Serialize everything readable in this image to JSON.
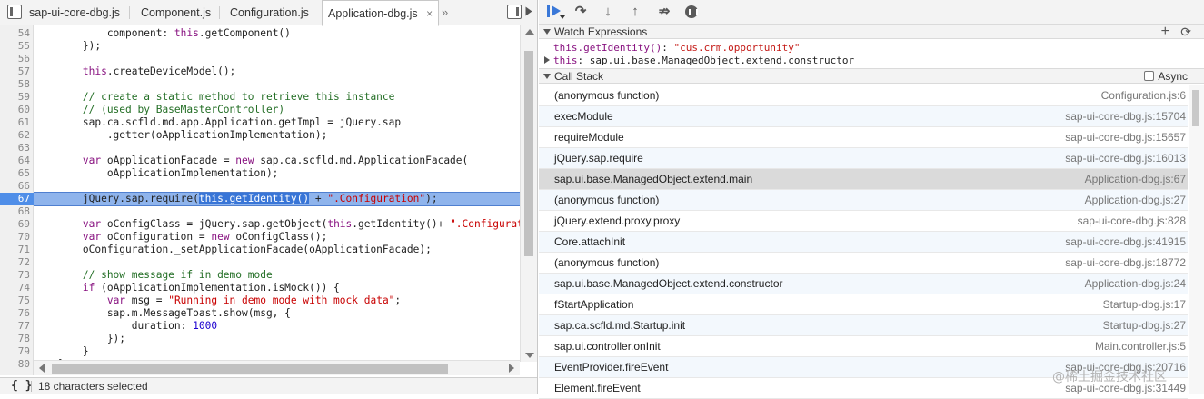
{
  "tabs": [
    {
      "label": "sap-ui-core-dbg.js",
      "active": false
    },
    {
      "label": "Component.js",
      "active": false
    },
    {
      "label": "Configuration.js",
      "active": false
    },
    {
      "label": "Application-dbg.js",
      "active": true,
      "close": "×"
    }
  ],
  "tabs_more": "»",
  "code_lines": [
    {
      "num": "54",
      "tokens": [
        {
          "t": "            component: "
        },
        {
          "t": "this",
          "c": "kw"
        },
        {
          "t": ".getComponent()"
        }
      ]
    },
    {
      "num": "55",
      "tokens": [
        {
          "t": "        });"
        }
      ]
    },
    {
      "num": "56",
      "tokens": []
    },
    {
      "num": "57",
      "tokens": [
        {
          "t": "        "
        },
        {
          "t": "this",
          "c": "kw"
        },
        {
          "t": ".createDeviceModel();"
        }
      ]
    },
    {
      "num": "58",
      "tokens": []
    },
    {
      "num": "59",
      "tokens": [
        {
          "t": "        // create a static method to retrieve this instance",
          "c": "cmt"
        }
      ]
    },
    {
      "num": "60",
      "tokens": [
        {
          "t": "        // (used by BaseMasterController)",
          "c": "cmt"
        }
      ]
    },
    {
      "num": "61",
      "tokens": [
        {
          "t": "        sap.ca.scfld.md.app.Application.getImpl = jQuery.sap"
        }
      ]
    },
    {
      "num": "62",
      "tokens": [
        {
          "t": "            .getter(oApplicationImplementation);"
        }
      ]
    },
    {
      "num": "63",
      "tokens": []
    },
    {
      "num": "64",
      "tokens": [
        {
          "t": "        "
        },
        {
          "t": "var",
          "c": "kw"
        },
        {
          "t": " oApplicationFacade = "
        },
        {
          "t": "new",
          "c": "kw"
        },
        {
          "t": " sap.ca.scfld.md.ApplicationFacade("
        }
      ]
    },
    {
      "num": "65",
      "tokens": [
        {
          "t": "            oApplicationImplementation);"
        }
      ]
    },
    {
      "num": "66",
      "tokens": []
    },
    {
      "num": "67",
      "exec": true,
      "tokens": [
        {
          "t": "        jQuery.sap.require("
        },
        {
          "t": "this.getIdentity()",
          "c": "sel"
        },
        {
          "t": " + "
        },
        {
          "t": "\".Configuration\"",
          "c": "str"
        },
        {
          "t": ");"
        }
      ]
    },
    {
      "num": "68",
      "tokens": []
    },
    {
      "num": "69",
      "tokens": [
        {
          "t": "        "
        },
        {
          "t": "var",
          "c": "kw"
        },
        {
          "t": " oConfigClass = jQuery.sap.getObject("
        },
        {
          "t": "this",
          "c": "kw"
        },
        {
          "t": ".getIdentity()+ "
        },
        {
          "t": "\".Configurati",
          "c": "str"
        }
      ]
    },
    {
      "num": "70",
      "tokens": [
        {
          "t": "        "
        },
        {
          "t": "var",
          "c": "kw"
        },
        {
          "t": " oConfiguration = "
        },
        {
          "t": "new",
          "c": "kw"
        },
        {
          "t": " oConfigClass();"
        }
      ]
    },
    {
      "num": "71",
      "tokens": [
        {
          "t": "        oConfiguration._setApplicationFacade(oApplicationFacade);"
        }
      ]
    },
    {
      "num": "72",
      "tokens": []
    },
    {
      "num": "73",
      "tokens": [
        {
          "t": "        // show message if in demo mode",
          "c": "cmt"
        }
      ]
    },
    {
      "num": "74",
      "tokens": [
        {
          "t": "        "
        },
        {
          "t": "if",
          "c": "kw"
        },
        {
          "t": " (oApplicationImplementation.isMock()) {"
        }
      ]
    },
    {
      "num": "75",
      "tokens": [
        {
          "t": "            "
        },
        {
          "t": "var",
          "c": "kw"
        },
        {
          "t": " msg = "
        },
        {
          "t": "\"Running in demo mode with mock data\"",
          "c": "str"
        },
        {
          "t": ";"
        }
      ]
    },
    {
      "num": "76",
      "tokens": [
        {
          "t": "            sap.m.MessageToast.show(msg, {"
        }
      ]
    },
    {
      "num": "77",
      "tokens": [
        {
          "t": "                duration: "
        },
        {
          "t": "1000",
          "c": "num"
        }
      ]
    },
    {
      "num": "78",
      "tokens": [
        {
          "t": "            });"
        }
      ]
    },
    {
      "num": "79",
      "tokens": [
        {
          "t": "        }"
        }
      ]
    },
    {
      "num": "80",
      "tokens": [
        {
          "t": "    },"
        }
      ]
    }
  ],
  "statusbar": {
    "format_label": "{ }",
    "selection": "18 characters selected"
  },
  "watch": {
    "title": "Watch Expressions",
    "add": "+",
    "refresh": "⟳",
    "items": [
      {
        "expr": "this.getIdentity()",
        "sep": ": ",
        "value": "\"cus.crm.opportunity\"",
        "kind": "str"
      },
      {
        "expr": "this",
        "sep": ": ",
        "value": "sap.ui.base.ManagedObject.extend.constructor",
        "kind": "obj"
      }
    ]
  },
  "callstack": {
    "title": "Call Stack",
    "async_label": "Async",
    "async_checked": false,
    "frames": [
      {
        "name": "(anonymous function)",
        "loc": "Configuration.js:6"
      },
      {
        "name": "execModule",
        "loc": "sap-ui-core-dbg.js:15704"
      },
      {
        "name": "requireModule",
        "loc": "sap-ui-core-dbg.js:15657"
      },
      {
        "name": "jQuery.sap.require",
        "loc": "sap-ui-core-dbg.js:16013"
      },
      {
        "name": "sap.ui.base.ManagedObject.extend.main",
        "loc": "Application-dbg.js:67",
        "selected": true
      },
      {
        "name": "(anonymous function)",
        "loc": "Application-dbg.js:27"
      },
      {
        "name": "jQuery.extend.proxy.proxy",
        "loc": "sap-ui-core-dbg.js:828"
      },
      {
        "name": "Core.attachInit",
        "loc": "sap-ui-core-dbg.js:41915"
      },
      {
        "name": "(anonymous function)",
        "loc": "sap-ui-core-dbg.js:18772"
      },
      {
        "name": "sap.ui.base.ManagedObject.extend.constructor",
        "loc": "Application-dbg.js:24"
      },
      {
        "name": "fStartApplication",
        "loc": "Startup-dbg.js:17"
      },
      {
        "name": "sap.ca.scfld.md.Startup.init",
        "loc": "Startup-dbg.js:27"
      },
      {
        "name": "sap.ui.controller.onInit",
        "loc": "Main.controller.js:5"
      },
      {
        "name": "EventProvider.fireEvent",
        "loc": "sap-ui-core-dbg.js:20716"
      },
      {
        "name": "Element.fireEvent",
        "loc": "sap-ui-core-dbg.js:31449"
      }
    ]
  },
  "watermark": "@稀土掘金技术社区"
}
